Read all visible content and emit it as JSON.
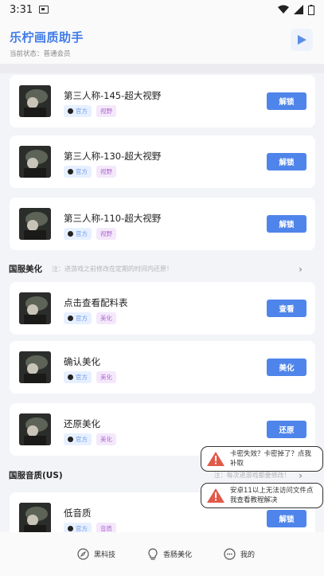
{
  "status_bar": {
    "time": "3:31"
  },
  "header": {
    "title": "乐柠画质助手",
    "status_label": "当前状态：",
    "status_value": "普通会员"
  },
  "cards_group1": [
    {
      "title": "第三人称-145-超大视野",
      "tag1": "官方",
      "tag2": "视野",
      "action": "解锁"
    },
    {
      "title": "第三人称-130-超大视野",
      "tag1": "官方",
      "tag2": "视野",
      "action": "解锁"
    },
    {
      "title": "第三人称-110-超大视野",
      "tag1": "官方",
      "tag2": "视野",
      "action": "解锁"
    }
  ],
  "section_guofu": {
    "title": "国服美化",
    "note": "注：进游戏之前修改在定期的时间内还原！"
  },
  "cards_group2": [
    {
      "title": "点击查看配料表",
      "tag1": "官方",
      "tag2": "美化",
      "action": "查看"
    },
    {
      "title": "确认美化",
      "tag1": "官方",
      "tag2": "美化",
      "action": "美化"
    },
    {
      "title": "还原美化",
      "tag1": "官方",
      "tag2": "美化",
      "action": "还原"
    }
  ],
  "section_audio": {
    "title": "国服音质(US)",
    "note": "注：每次进游戏都要修改！"
  },
  "cards_group3": [
    {
      "title": "低音质",
      "tag1": "官方",
      "tag2": "音质",
      "action": "解锁"
    }
  ],
  "toasts": [
    {
      "text": "卡密失效？卡密掉了？点我补取"
    },
    {
      "text": "安卓11以上无法访问文件点我查看教程解决"
    }
  ],
  "bottom_nav": [
    {
      "label": "黑科技",
      "icon": "compass-icon"
    },
    {
      "label": "香肠美化",
      "icon": "bulb-icon"
    },
    {
      "label": "我的",
      "icon": "user-icon"
    }
  ],
  "colors": {
    "accent": "#4f85ea",
    "title": "#3f7be8"
  }
}
